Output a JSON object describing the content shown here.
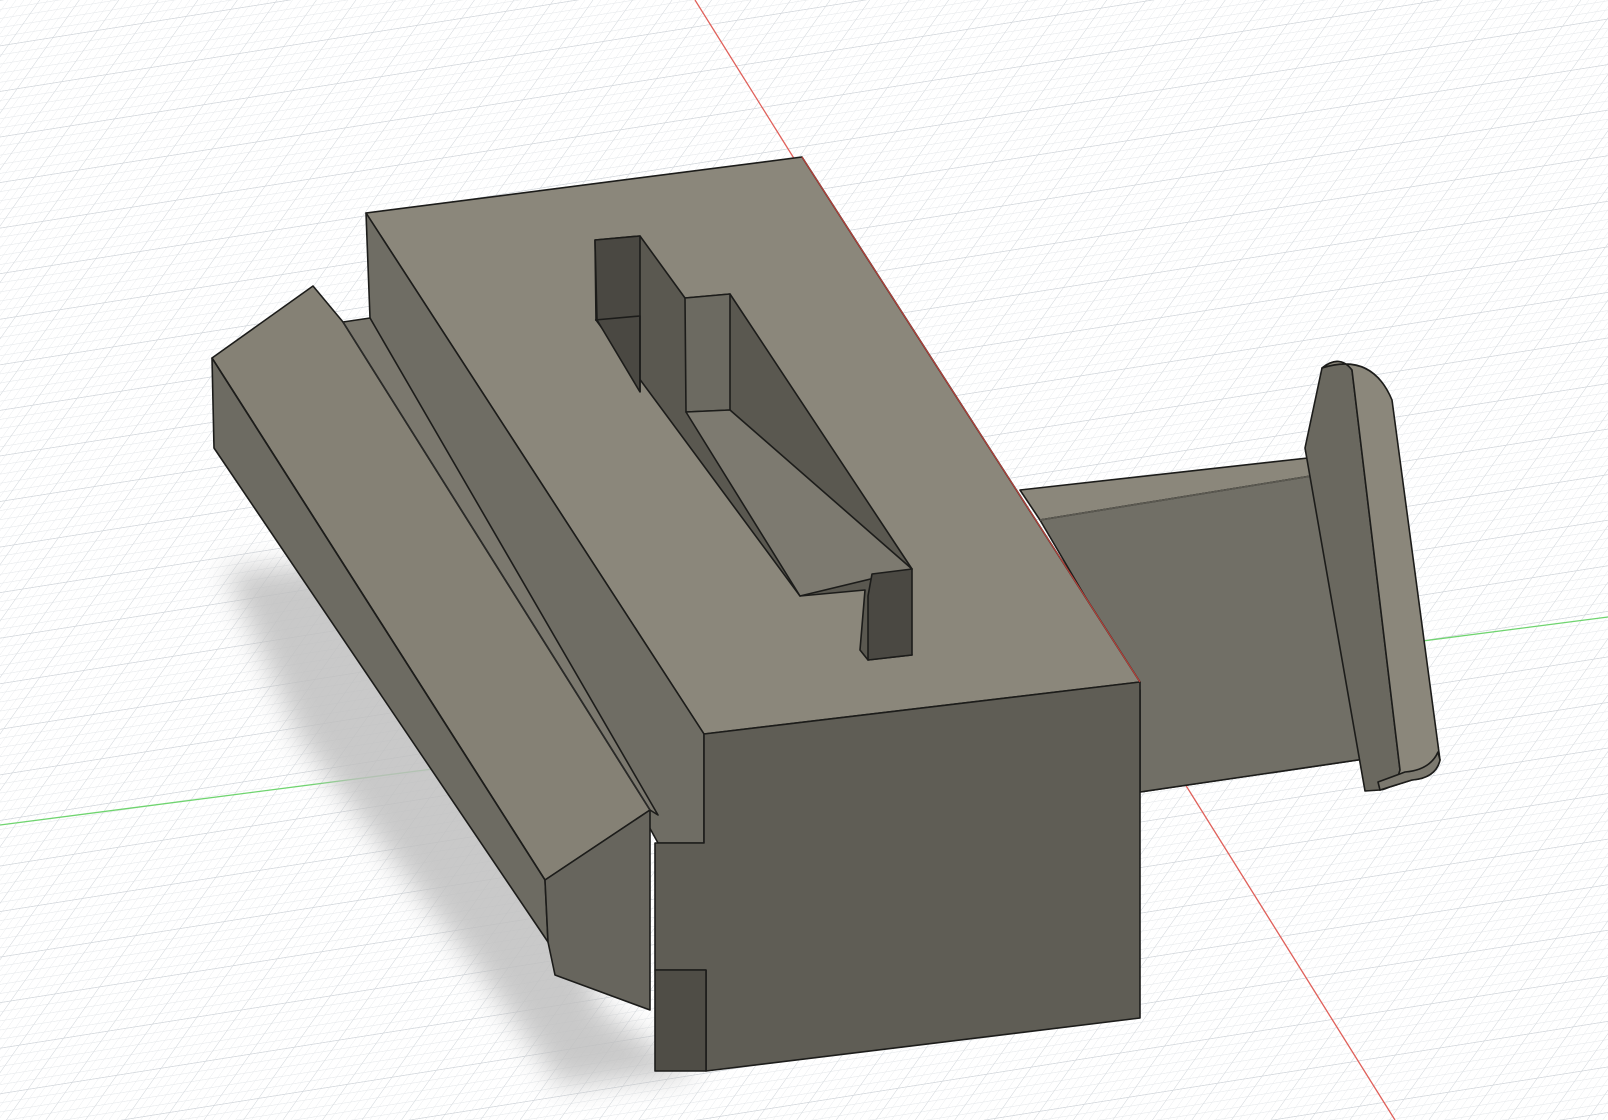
{
  "colors": {
    "background": "#ffffff",
    "grid_minor": "#e4e7ea",
    "grid_major": "#ccd1d6",
    "x_axis": "#e0605a",
    "y_axis": "#6fd46f",
    "model_edge": "#1c1c1a",
    "face_top": "#8b877b",
    "face_top_dark": "#7a766b",
    "face_side": "#6c6a61",
    "face_front": "#5f5d55",
    "face_groove": "#4f4d46",
    "shadow": "#c4c4c4"
  },
  "icons": {
    "viewport": "3d-canvas-icon"
  }
}
